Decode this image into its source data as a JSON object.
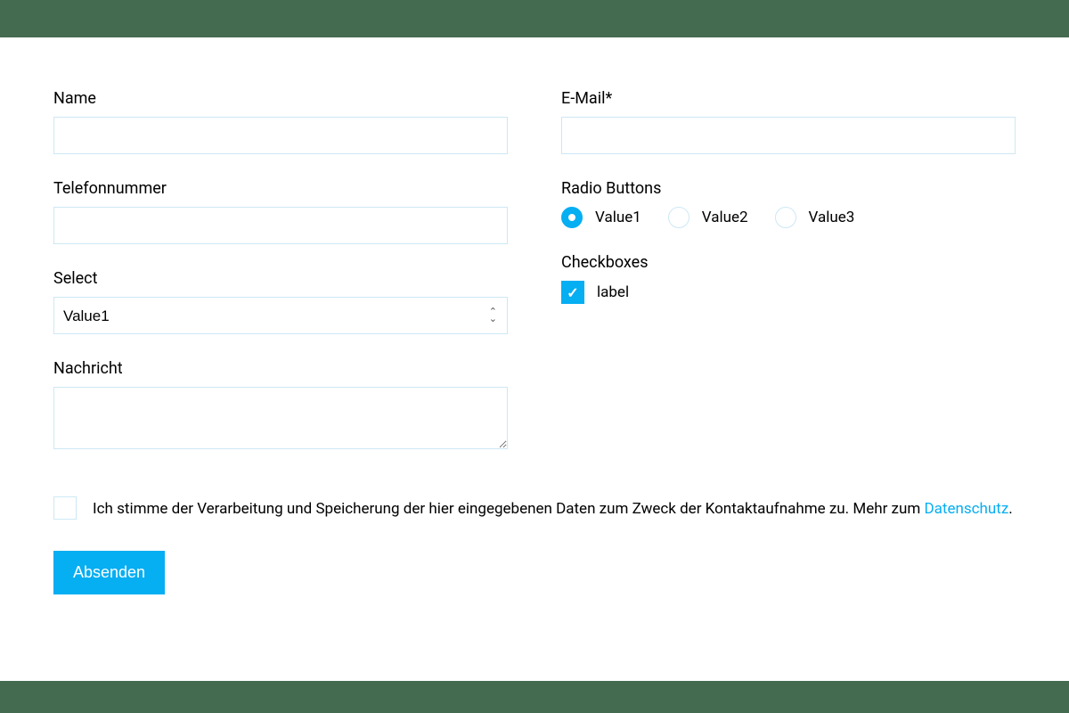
{
  "form": {
    "left": {
      "name": {
        "label": "Name",
        "value": ""
      },
      "phone": {
        "label": "Telefonnummer",
        "value": ""
      },
      "select": {
        "label": "Select",
        "selected": "Value1"
      },
      "message": {
        "label": "Nachricht",
        "value": ""
      }
    },
    "right": {
      "email": {
        "label": "E-Mail*",
        "value": ""
      },
      "radio": {
        "label": "Radio Buttons",
        "options": [
          "Value1",
          "Value2",
          "Value3"
        ],
        "selected": "Value1"
      },
      "checkboxes": {
        "label": "Checkboxes",
        "item": {
          "label": "label",
          "checked": true
        }
      }
    },
    "consent": {
      "text_before": "Ich stimme der Verarbeitung und Speicherung der hier eingegebenen Daten zum Zweck der Kontaktaufnahme zu. Mehr zum ",
      "link": "Datenschutz",
      "text_after": ".",
      "checked": false
    },
    "submit": "Absenden"
  },
  "colors": {
    "accent": "#06aef2",
    "border": "#cde8f5",
    "band": "#446a4f"
  }
}
